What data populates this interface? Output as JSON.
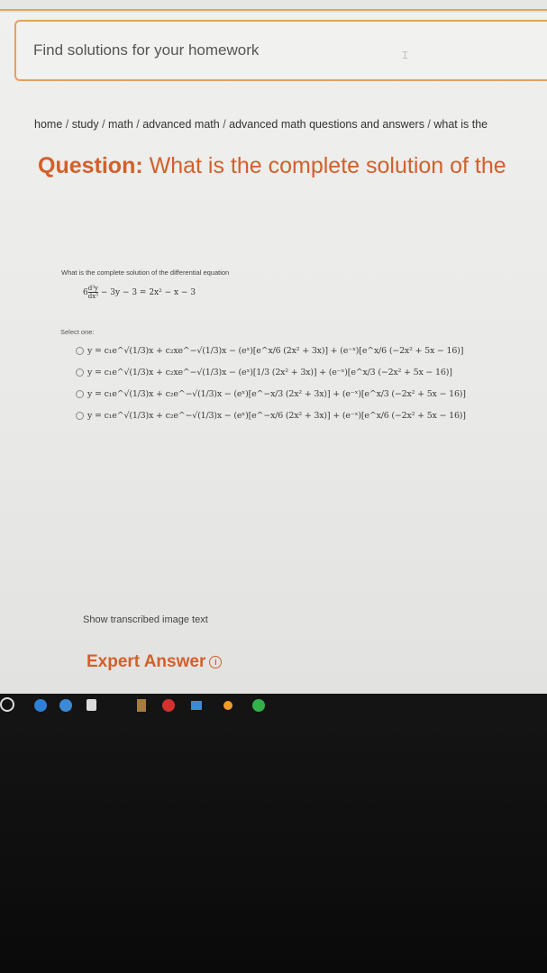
{
  "search": {
    "placeholder": "Find solutions for your homework"
  },
  "breadcrumb": {
    "items": [
      "home",
      "study",
      "math",
      "advanced math",
      "advanced math questions and answers",
      "what is the"
    ],
    "separator": " / "
  },
  "question": {
    "label": "Question:",
    "title": "What is the complete solution of the"
  },
  "question_image": {
    "prompt": "What is the complete solution of the differential equation",
    "equation_lead": "6",
    "equation_frac_num": "d³y",
    "equation_frac_den": "dx³",
    "equation_rest": "− 3y − 3 = 2x² − x − 3",
    "select_label": "Select one:",
    "options": [
      "y = c₁e^√(1/3)x + c₂xe^−√(1/3)x − (eˣ)[e^x/6 (2x² + 3x)] + (e⁻ˣ)[e^x/6 (−2x² + 5x − 16)]",
      "y = c₁e^√(1/3)x + c₂xe^−√(1/3)x − (eˣ)[1/3 (2x² + 3x)] + (e⁻ˣ)[e^x/3 (−2x² + 5x − 16)]",
      "y = c₁e^√(1/3)x + c₂e^−√(1/3)x − (eˣ)[e^−x/3 (2x² + 3x)] + (e⁻ˣ)[e^x/3 (−2x² + 5x − 16)]",
      "y = c₁e^√(1/3)x + c₂e^−√(1/3)x − (eˣ)[e^−x/6 (2x² + 3x)] + (e⁻ˣ)[e^x/6 (−2x² + 5x − 16)]"
    ]
  },
  "show_transcribed": "Show transcribed image text",
  "expert_answer": {
    "label": "Expert Answer",
    "info_icon": "i"
  },
  "taskbar": {
    "icons": [
      "start-icon",
      "cortana-icon",
      "edge-icon",
      "store-icon",
      "app1-icon",
      "chrome-icon",
      "mail-icon",
      "app2-icon",
      "whatsapp-icon"
    ]
  },
  "colors": {
    "accent": "#d35f2a",
    "border": "#e3a15e"
  }
}
